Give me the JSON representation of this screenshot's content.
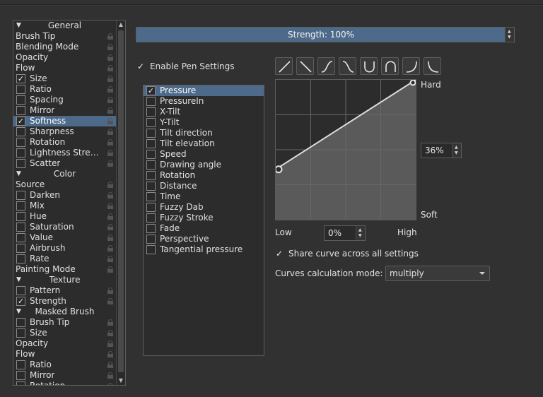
{
  "left_list": {
    "rows": [
      {
        "label": "General",
        "kind": "header"
      },
      {
        "label": "Brush Tip",
        "kind": "plain"
      },
      {
        "label": "Blending Mode",
        "kind": "plain"
      },
      {
        "label": "Opacity",
        "kind": "plain"
      },
      {
        "label": "Flow",
        "kind": "plain"
      },
      {
        "label": "Size",
        "kind": "check",
        "checked": true
      },
      {
        "label": "Ratio",
        "kind": "check",
        "checked": false
      },
      {
        "label": "Spacing",
        "kind": "check",
        "checked": false
      },
      {
        "label": "Mirror",
        "kind": "check",
        "checked": false
      },
      {
        "label": "Softness",
        "kind": "check",
        "checked": true,
        "selected": true
      },
      {
        "label": "Sharpness",
        "kind": "check",
        "checked": false
      },
      {
        "label": "Rotation",
        "kind": "check",
        "checked": false
      },
      {
        "label": "Lightness Stren...",
        "kind": "check",
        "checked": false
      },
      {
        "label": "Scatter",
        "kind": "check",
        "checked": false
      },
      {
        "label": "Color",
        "kind": "header"
      },
      {
        "label": "Source",
        "kind": "plain"
      },
      {
        "label": "Darken",
        "kind": "check",
        "checked": false
      },
      {
        "label": "Mix",
        "kind": "check",
        "checked": false
      },
      {
        "label": "Hue",
        "kind": "check",
        "checked": false
      },
      {
        "label": "Saturation",
        "kind": "check",
        "checked": false
      },
      {
        "label": "Value",
        "kind": "check",
        "checked": false
      },
      {
        "label": "Airbrush",
        "kind": "check",
        "checked": false
      },
      {
        "label": "Rate",
        "kind": "check",
        "checked": false
      },
      {
        "label": "Painting Mode",
        "kind": "plain"
      },
      {
        "label": "Texture",
        "kind": "header"
      },
      {
        "label": "Pattern",
        "kind": "check",
        "checked": false
      },
      {
        "label": "Strength",
        "kind": "check",
        "checked": true
      },
      {
        "label": "Masked Brush",
        "kind": "header"
      },
      {
        "label": "Brush Tip",
        "kind": "check",
        "checked": false
      },
      {
        "label": "Size",
        "kind": "check",
        "checked": false
      },
      {
        "label": "Opacity",
        "kind": "plain"
      },
      {
        "label": "Flow",
        "kind": "plain"
      },
      {
        "label": "Ratio",
        "kind": "check",
        "checked": false
      },
      {
        "label": "Mirror",
        "kind": "check",
        "checked": false
      },
      {
        "label": "Rotation",
        "kind": "check",
        "checked": false
      }
    ]
  },
  "strength": {
    "text": "Strength: 100%",
    "fraction": 1.0
  },
  "enable_pen": {
    "label": "Enable Pen Settings",
    "checked": true
  },
  "sensors": [
    {
      "label": "Pressure",
      "checked": true,
      "selected": true
    },
    {
      "label": "PressureIn",
      "checked": false
    },
    {
      "label": "X-Tilt",
      "checked": false
    },
    {
      "label": "Y-Tilt",
      "checked": false
    },
    {
      "label": "Tilt direction",
      "checked": false
    },
    {
      "label": "Tilt elevation",
      "checked": false
    },
    {
      "label": "Speed",
      "checked": false
    },
    {
      "label": "Drawing angle",
      "checked": false
    },
    {
      "label": "Rotation",
      "checked": false
    },
    {
      "label": "Distance",
      "checked": false
    },
    {
      "label": "Time",
      "checked": false
    },
    {
      "label": "Fuzzy Dab",
      "checked": false
    },
    {
      "label": "Fuzzy Stroke",
      "checked": false
    },
    {
      "label": "Fade",
      "checked": false
    },
    {
      "label": "Perspective",
      "checked": false
    },
    {
      "label": "Tangential pressure",
      "checked": false
    }
  ],
  "curve_presets": [
    "linear-up-icon",
    "linear-down-icon",
    "s-curve-up-icon",
    "s-curve-down-icon",
    "u-curve-icon",
    "arch-curve-icon",
    "j-curve-icon",
    "l-curve-icon"
  ],
  "curve": {
    "points": [
      [
        0,
        0.36
      ],
      [
        1,
        1
      ]
    ],
    "label_hard": "Hard",
    "label_soft": "Soft",
    "label_low": "Low",
    "label_high": "High"
  },
  "curve_value": "36%",
  "low_value": "0%",
  "share_curve": {
    "label": "Share curve across all settings",
    "checked": true
  },
  "calc_mode": {
    "label": "Curves calculation mode:",
    "value": "multiply"
  },
  "colors": {
    "accent": "#4d6a8a",
    "background": "#313131",
    "panel": "#2c2c2c"
  }
}
